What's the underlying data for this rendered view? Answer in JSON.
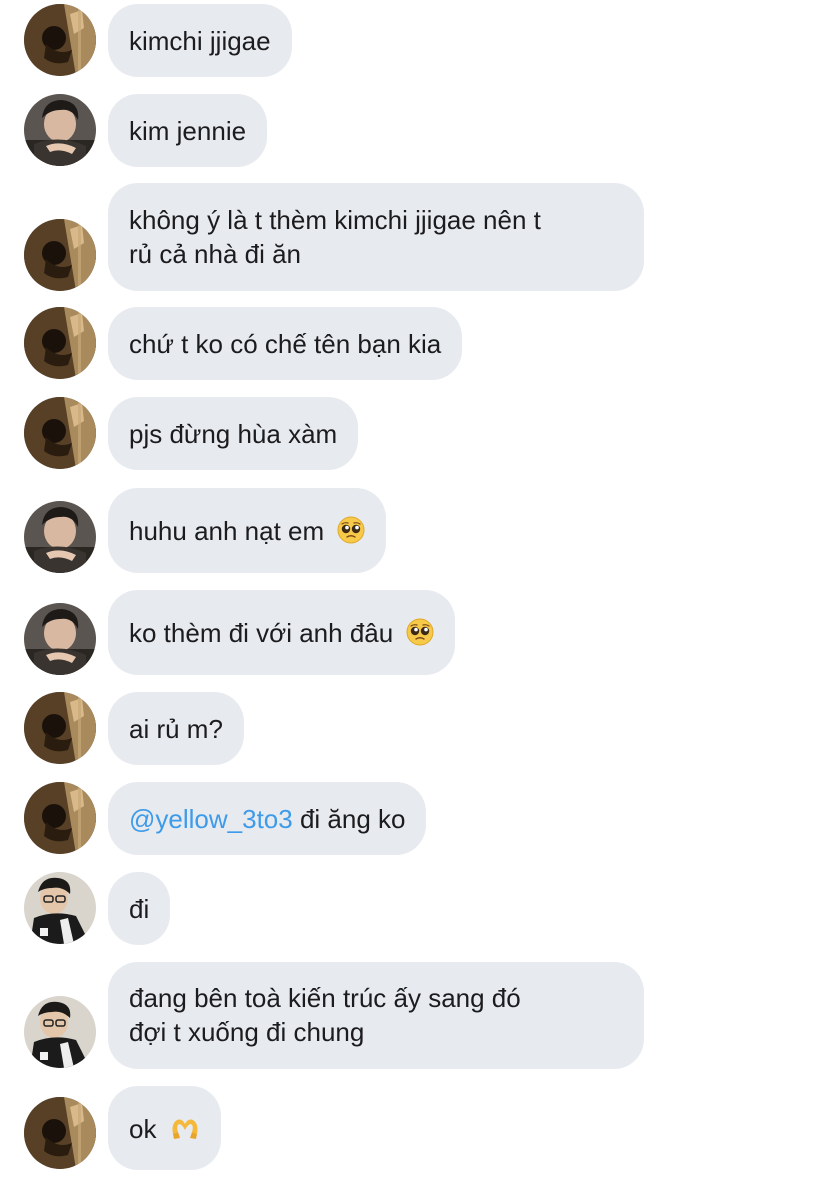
{
  "conversation": {
    "messages": [
      {
        "sender": "user-a",
        "text": "kimchi jjigae"
      },
      {
        "sender": "user-b",
        "text": "kim jennie"
      },
      {
        "sender": "user-a",
        "line1": "không ý là t thèm kimchi jjigae nên t",
        "line2": "rủ cả nhà đi ăn"
      },
      {
        "sender": "user-a",
        "text": "chứ t ko có chế tên bạn kia"
      },
      {
        "sender": "user-a",
        "text": "pjs đừng hùa xàm"
      },
      {
        "sender": "user-b",
        "text": "huhu anh nạt em",
        "emoji": "pleading-face-emoji"
      },
      {
        "sender": "user-b",
        "text": "ko thèm đi với anh đâu",
        "emoji": "pleading-face-emoji"
      },
      {
        "sender": "user-a",
        "text": "ai rủ m?"
      },
      {
        "sender": "user-a",
        "mention": "@yellow_3to3",
        "text": " đi ăng ko"
      },
      {
        "sender": "user-c",
        "text": "đi"
      },
      {
        "sender": "user-c",
        "line1": "đang bên toà kiến trúc ấy sang đó",
        "line2": "đợi t xuống đi chung"
      },
      {
        "sender": "user-a",
        "text": "ok",
        "emoji": "heart-hands-emoji"
      }
    ]
  },
  "colors": {
    "bubble_bg": "#e7eaef",
    "text": "#1c1c1e",
    "mention": "#3d9be9"
  }
}
